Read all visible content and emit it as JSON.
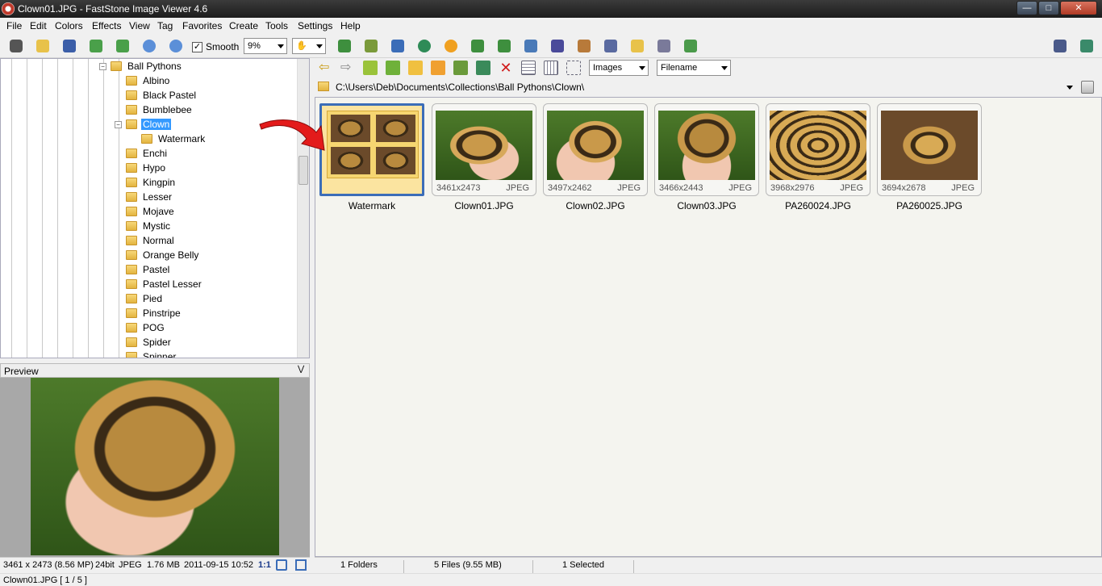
{
  "window": {
    "title": "Clown01.JPG  -  FastStone Image Viewer 4.6"
  },
  "menu": [
    "File",
    "Edit",
    "Colors",
    "Effects",
    "View",
    "Tag",
    "Favorites",
    "Create",
    "Tools",
    "Settings",
    "Help"
  ],
  "toolbar": {
    "smooth_label": "Smooth",
    "smooth_checked": true,
    "zoom_value": "9%"
  },
  "tree": {
    "parent": "Ball Pythons",
    "items": [
      "Albino",
      "Black Pastel",
      "Bumblebee",
      "Clown",
      "Watermark",
      "Enchi",
      "Hypo",
      "Kingpin",
      "Lesser",
      "Mojave",
      "Mystic",
      "Normal",
      "Orange Belly",
      "Pastel",
      "Pastel Lesser",
      "Pied",
      "Pinstripe",
      "POG",
      "Spider",
      "Spinner"
    ],
    "selected": "Clown"
  },
  "preview": {
    "label": "Preview"
  },
  "status_left": {
    "dims": "3461 x 2473 (8.56 MP)",
    "depth": "24bit",
    "format": "JPEG",
    "size": "1.76 MB",
    "date": "2011-09-15 10:52",
    "ratio": "1:1"
  },
  "status_bottom": {
    "file": "Clown01.JPG [ 1 / 5 ]"
  },
  "browser": {
    "filter": "Images",
    "sort": "Filename",
    "path": "C:\\Users\\Deb\\Documents\\Collections\\Ball Pythons\\Clown\\"
  },
  "thumbnails": [
    {
      "name": "Watermark",
      "dims": "",
      "format": ""
    },
    {
      "name": "Clown01.JPG",
      "dims": "3461x2473",
      "format": "JPEG"
    },
    {
      "name": "Clown02.JPG",
      "dims": "3497x2462",
      "format": "JPEG"
    },
    {
      "name": "Clown03.JPG",
      "dims": "3466x2443",
      "format": "JPEG"
    },
    {
      "name": "PA260024.JPG",
      "dims": "3968x2976",
      "format": "JPEG"
    },
    {
      "name": "PA260025.JPG",
      "dims": "3694x2678",
      "format": "JPEG"
    }
  ],
  "status_right": {
    "folders": "1 Folders",
    "files": "5 Files (9.55 MB)",
    "selected": "1 Selected"
  },
  "colors": {
    "selection_blue": "#3b6db8",
    "highlight": "#3399ff",
    "arrow_red": "#e31b1b"
  }
}
